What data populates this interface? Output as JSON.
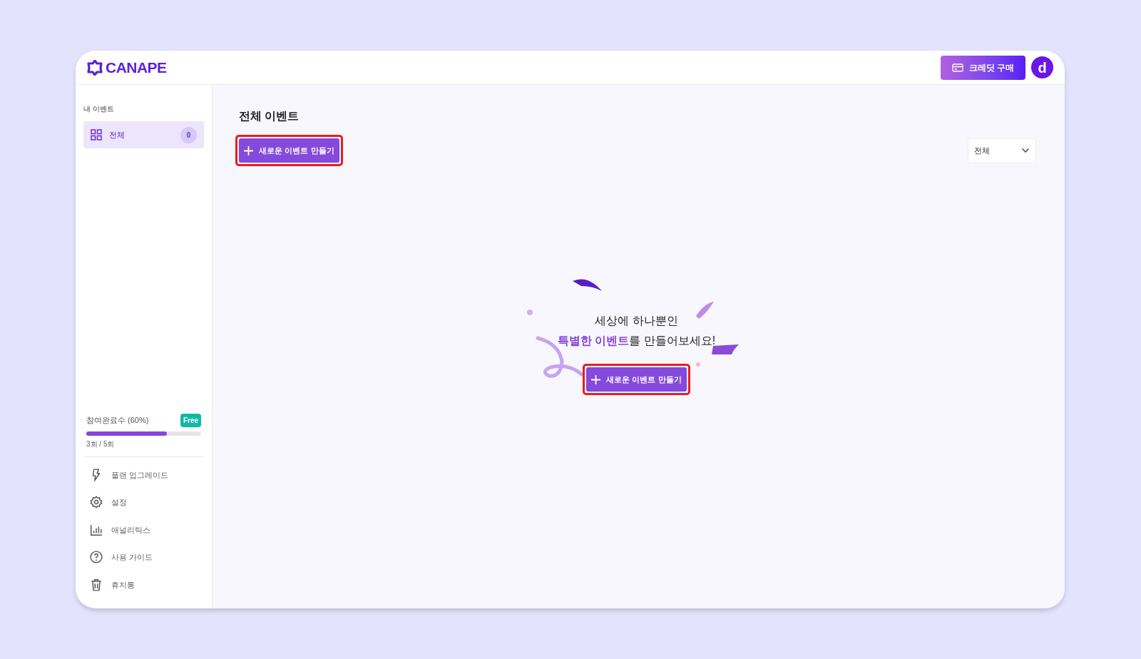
{
  "header": {
    "logo": "CANAPE",
    "credit_button": "크레딧 구매",
    "avatar": "d"
  },
  "sidebar": {
    "section_title": "내 이벤트",
    "items": [
      {
        "label": "전체",
        "count": "0",
        "selected": true
      }
    ],
    "usage": {
      "label": "참여완료수 (60%)",
      "plan_badge": "Free",
      "level": 0.7,
      "reading": "3회 / 5회"
    },
    "menu": [
      {
        "kind": "upgrade",
        "label": "플랜 업그레이드"
      },
      {
        "kind": "settings",
        "label": "설정"
      },
      {
        "kind": "analytics",
        "label": "애널리틱스"
      },
      {
        "kind": "guide",
        "label": "사용 가이드"
      },
      {
        "kind": "trash",
        "label": "휴지통"
      }
    ]
  },
  "main": {
    "title": "전체 이벤트",
    "create_button": "새로운 이벤트 만들기",
    "filter": {
      "value": "전체"
    },
    "empty_state": {
      "line_1": "세상에 하나뿐인",
      "accent": "특별한 이벤트",
      "line_2_rest": "를 만들어보세요!",
      "create_button": "새로운 이벤트 만들기"
    }
  }
}
